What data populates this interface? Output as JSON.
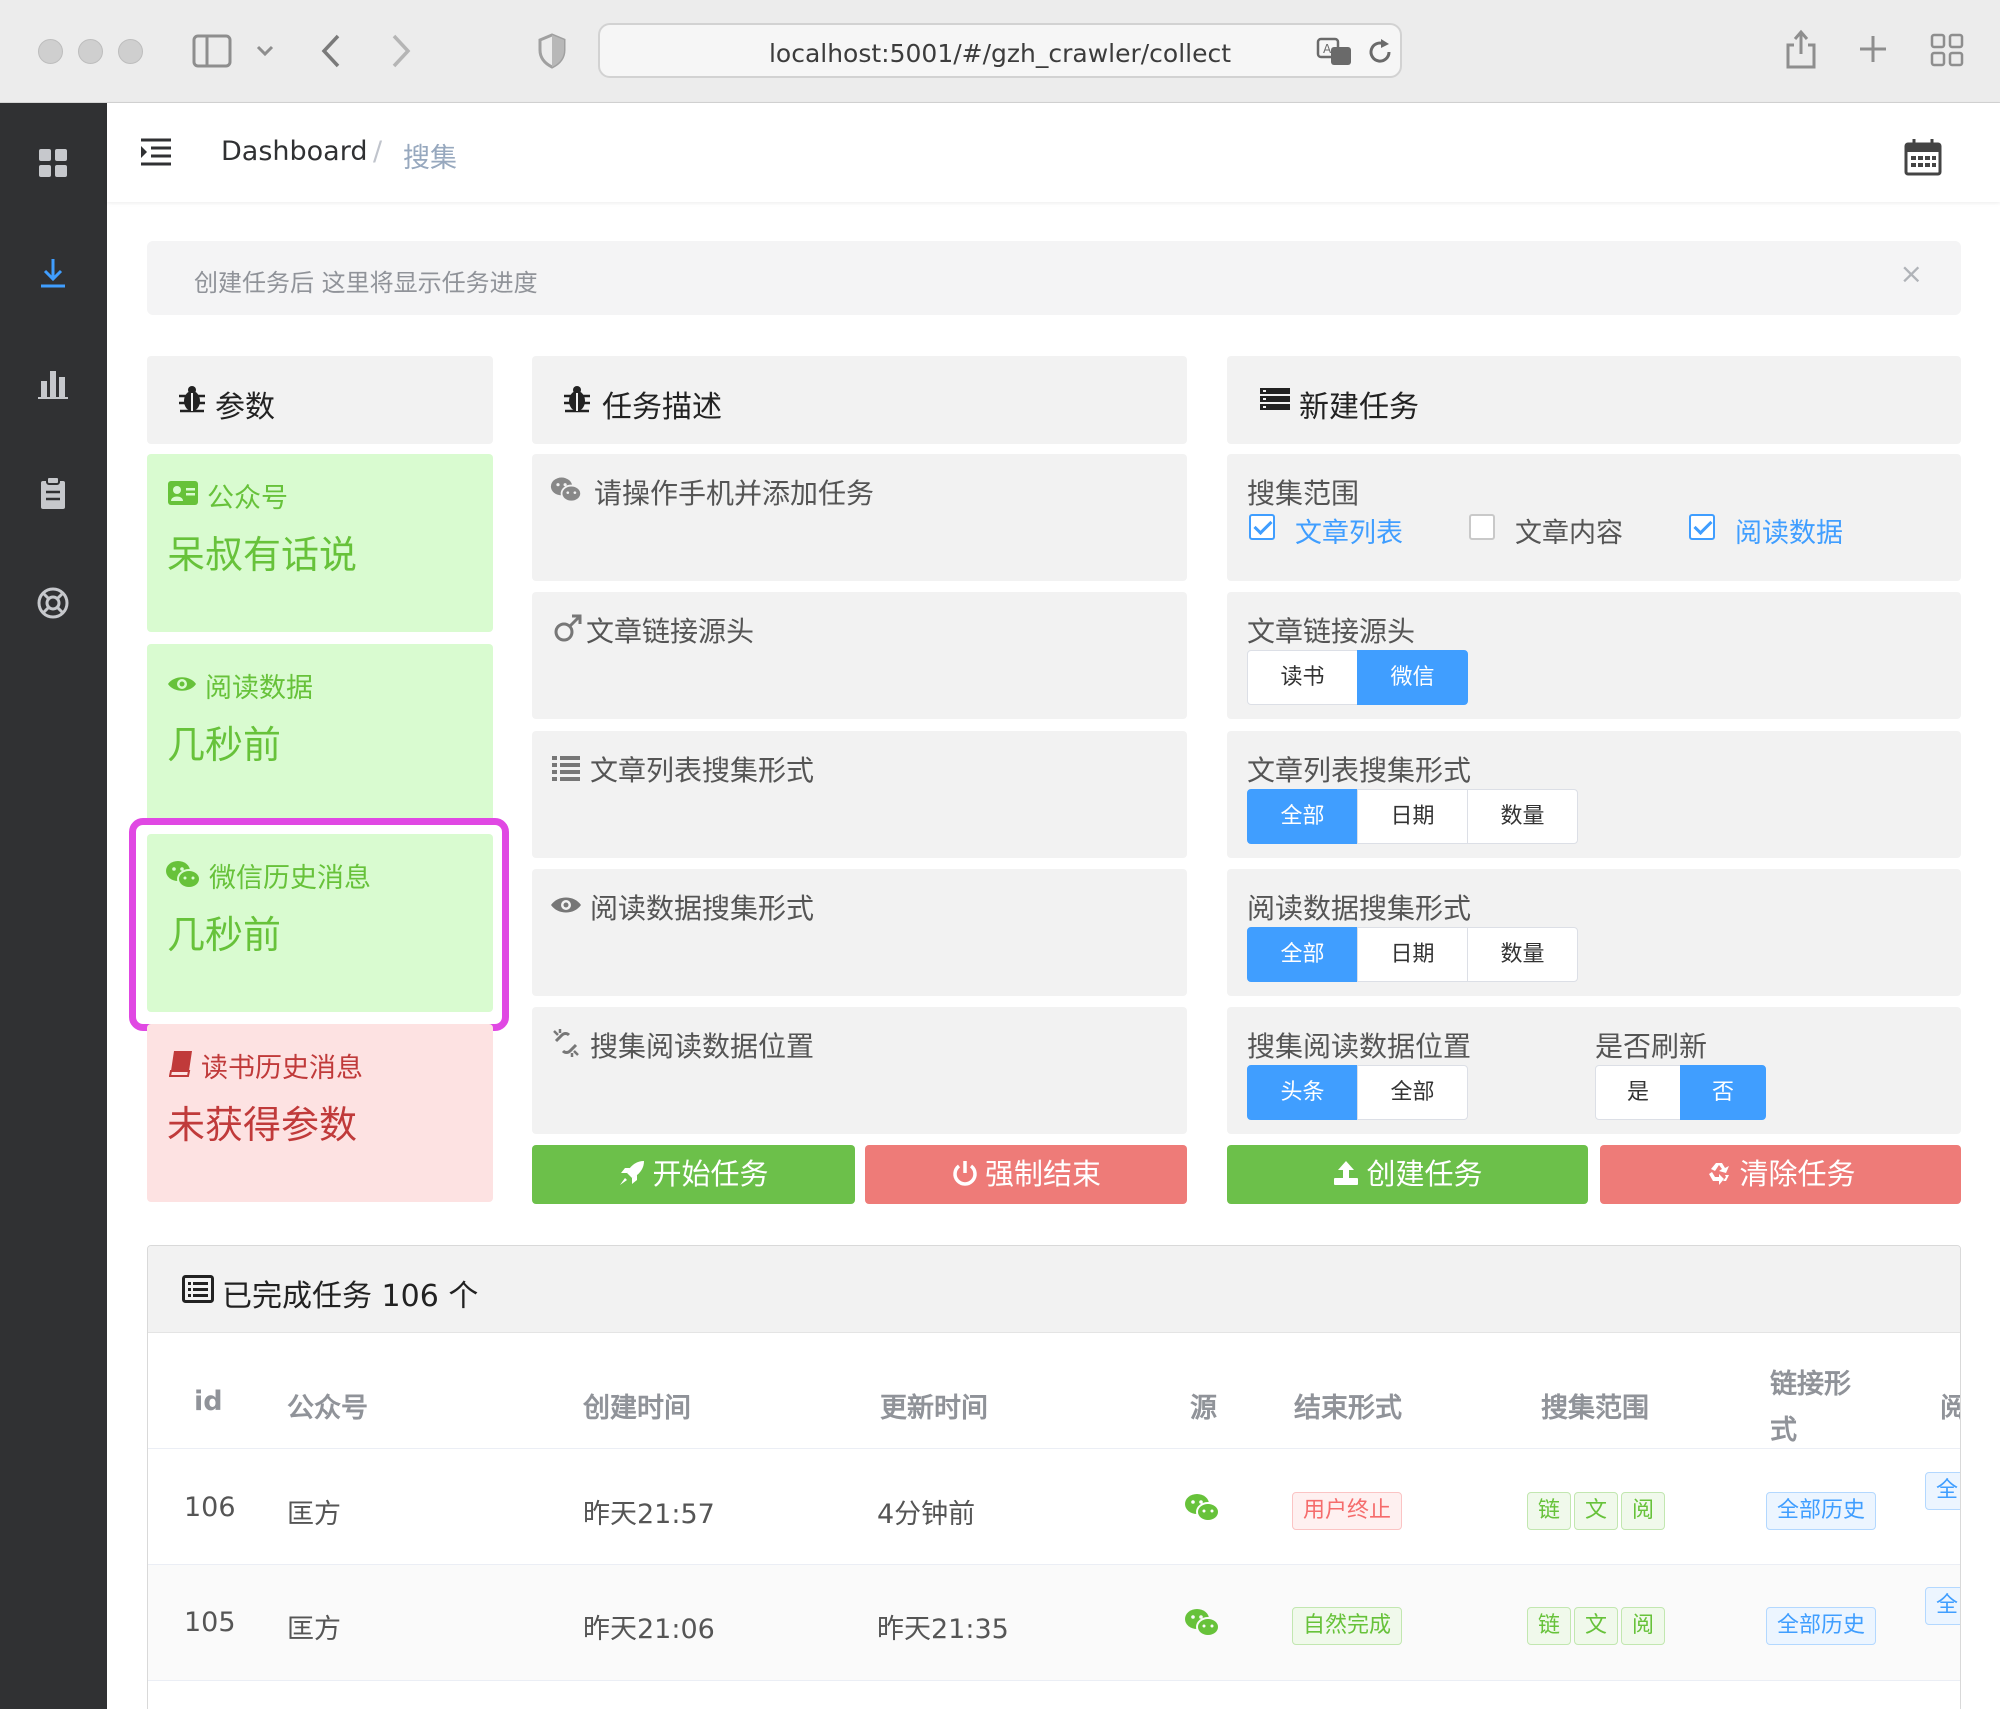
{
  "browser": {
    "url": "localhost:5001/#/gzh_crawler/collect"
  },
  "breadcrumb": {
    "home": "Dashboard",
    "separator": "/",
    "current": "搜集"
  },
  "alert": {
    "message": "创建任务后 这里将显示任务进度",
    "close": "×"
  },
  "params": {
    "title": "参数",
    "cards": [
      {
        "label": "公众号",
        "value": "呆叔有话说",
        "status": "ok"
      },
      {
        "label": "阅读数据",
        "value": "几秒前",
        "status": "ok"
      },
      {
        "label": "微信历史消息",
        "value": "几秒前",
        "status": "ok"
      },
      {
        "label": "读书历史消息",
        "value": "未获得参数",
        "status": "error"
      }
    ]
  },
  "task_desc": {
    "title": "任务描述",
    "items": [
      "请操作手机并添加任务",
      "文章链接源头",
      "文章列表搜集形式",
      "阅读数据搜集形式",
      "搜集阅读数据位置"
    ],
    "start_button": "开始任务",
    "stop_button": "强制结束"
  },
  "new_task": {
    "title": "新建任务",
    "scope_label": "搜集范围",
    "scope_options": [
      {
        "label": "文章列表",
        "checked": true
      },
      {
        "label": "文章内容",
        "checked": false
      },
      {
        "label": "阅读数据",
        "checked": true
      }
    ],
    "source_label": "文章链接源头",
    "source_options": [
      "读书",
      "微信"
    ],
    "source_selected": "微信",
    "list_mode_label": "文章列表搜集形式",
    "list_mode_options": [
      "全部",
      "日期",
      "数量"
    ],
    "list_mode_selected": "全部",
    "read_mode_label": "阅读数据搜集形式",
    "read_mode_options": [
      "全部",
      "日期",
      "数量"
    ],
    "read_mode_selected": "全部",
    "position_label": "搜集阅读数据位置",
    "position_options": [
      "头条",
      "全部"
    ],
    "position_selected": "头条",
    "refresh_label": "是否刷新",
    "refresh_options": [
      "是",
      "否"
    ],
    "refresh_selected": "否",
    "create_button": "创建任务",
    "clear_button": "清除任务"
  },
  "completed": {
    "title": "已完成任务 106 个",
    "columns": [
      "id",
      "公众号",
      "创建时间",
      "更新时间",
      "源",
      "结束形式",
      "搜集范围",
      "链接形式",
      "阅"
    ],
    "link_col_line1": "链接形",
    "link_col_line2": "式",
    "rows": [
      {
        "id": "106",
        "name": "匡方",
        "created": "昨天21:57",
        "updated": "4分钟前",
        "end": "用户终止",
        "end_type": "red",
        "scope": [
          "链",
          "文",
          "阅"
        ],
        "link": "全部历史",
        "extra": "全"
      },
      {
        "id": "105",
        "name": "匡方",
        "created": "昨天21:06",
        "updated": "昨天21:35",
        "end": "自然完成",
        "end_type": "green",
        "scope": [
          "链",
          "文",
          "阅"
        ],
        "link": "全部历史",
        "extra": "全"
      }
    ]
  },
  "colors": {
    "primary": "#409eff",
    "success_bg": "#d9fbd0",
    "success_text": "#67c23a",
    "danger_bg": "#fde2e2",
    "danger_text": "#c03a3a",
    "highlight": "#e048e3",
    "sidebar": "#303133"
  }
}
